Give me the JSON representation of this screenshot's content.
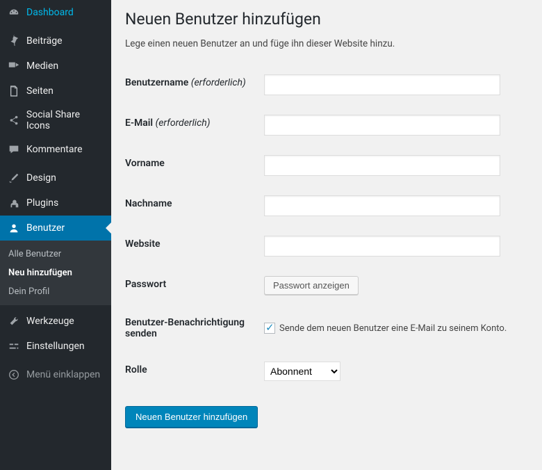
{
  "sidebar": {
    "items": [
      {
        "label": "Dashboard",
        "icon": "dashboard-icon"
      },
      {
        "label": "Beiträge",
        "icon": "pin-icon"
      },
      {
        "label": "Medien",
        "icon": "media-icon"
      },
      {
        "label": "Seiten",
        "icon": "page-icon"
      },
      {
        "label": "Social Share Icons",
        "icon": "share-icon"
      },
      {
        "label": "Kommentare",
        "icon": "comment-icon"
      },
      {
        "label": "Design",
        "icon": "brush-icon"
      },
      {
        "label": "Plugins",
        "icon": "plugin-icon"
      },
      {
        "label": "Benutzer",
        "icon": "user-icon",
        "current": true
      },
      {
        "label": "Werkzeuge",
        "icon": "tools-icon"
      },
      {
        "label": "Einstellungen",
        "icon": "settings-icon"
      },
      {
        "label": "Menü einklappen",
        "icon": "collapse-icon",
        "collapse": true
      }
    ],
    "submenu": [
      {
        "label": "Alle Benutzer"
      },
      {
        "label": "Neu hinzufügen",
        "current": true
      },
      {
        "label": "Dein Profil"
      }
    ]
  },
  "page": {
    "title": "Neuen Benutzer hinzufügen",
    "description": "Lege einen neuen Benutzer an und füge ihn dieser Website hinzu."
  },
  "form": {
    "username_label": "Benutzername",
    "required": "(erforderlich)",
    "email_label": "E-Mail",
    "firstname_label": "Vorname",
    "lastname_label": "Nachname",
    "website_label": "Website",
    "password_label": "Passwort",
    "show_password_btn": "Passwort anzeigen",
    "notify_label": "Benutzer-Benachrichtigung senden",
    "notify_checkbox": "Sende dem neuen Benutzer eine E-Mail zu seinem Konto.",
    "role_label": "Rolle",
    "role_value": "Abonnent",
    "submit": "Neuen Benutzer hinzufügen"
  }
}
